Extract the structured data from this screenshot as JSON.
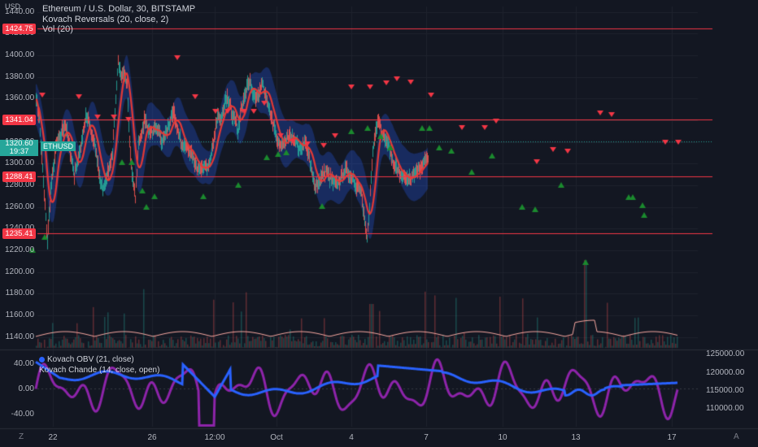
{
  "chart_data": {
    "type": "line",
    "title": "Ethereum / U.S. Dollar, 30, BITSTAMP",
    "symbol": "ETHUSD",
    "currency": "USD",
    "indicators": [
      "Kovach Reversals (20, close, 2)",
      "Vol (20)"
    ],
    "current_price": "1320.60",
    "countdown": "19:37",
    "levels": [
      1424.75,
      1341.04,
      1288.41,
      1235.41
    ],
    "ylim": [
      1130,
      1445
    ],
    "y_ticks": [
      "1440.00",
      "1420.00",
      "1400.00",
      "1380.00",
      "1360.00",
      "1340.00",
      "1320.00",
      "1300.00",
      "1280.00",
      "1260.00",
      "1240.00",
      "1220.00",
      "1200.00",
      "1180.00",
      "1160.00",
      "1140.00"
    ],
    "x_ticks": [
      "22",
      "26",
      "12:00",
      "Oct",
      "4",
      "7",
      "10",
      "13",
      "17"
    ],
    "x": [
      0,
      4,
      7,
      11,
      14,
      18,
      22,
      25,
      29,
      32,
      36,
      40,
      43,
      47,
      50,
      54,
      58,
      61,
      65,
      68,
      72,
      76,
      79,
      83,
      86,
      90,
      94,
      97,
      101,
      104,
      108,
      112,
      115,
      119,
      122,
      126,
      130,
      133,
      137,
      140,
      144,
      148,
      151,
      155,
      158,
      162,
      166,
      169,
      173,
      176,
      180,
      184,
      187,
      191,
      194,
      198,
      202,
      205,
      209,
      212,
      216,
      220,
      223,
      227,
      230,
      234,
      238,
      241,
      245,
      248,
      252,
      256,
      259,
      263,
      266,
      270,
      274,
      277,
      281,
      284,
      288,
      292,
      295,
      299,
      302,
      306,
      310,
      313,
      317,
      320,
      324,
      328,
      331,
      335,
      338,
      342,
      346,
      349,
      353,
      356,
      360,
      364,
      367,
      371,
      374,
      378,
      382,
      385,
      389,
      392,
      396,
      400,
      403,
      407,
      410,
      414,
      418,
      421,
      425,
      428,
      432,
      436,
      439,
      443,
      446,
      450,
      454,
      457,
      461,
      464,
      468,
      472,
      475,
      479,
      482,
      486,
      490,
      493,
      497,
      500,
      504,
      508,
      511,
      515,
      518,
      522,
      526,
      529,
      533,
      536,
      540,
      544,
      547,
      551,
      554,
      558,
      562,
      565,
      569,
      572,
      576,
      580,
      583,
      587,
      590,
      594,
      598,
      601,
      605,
      608,
      612,
      616,
      619,
      623,
      626,
      630,
      634,
      637,
      641,
      644,
      648,
      652,
      655,
      659,
      662,
      666,
      670,
      673,
      677,
      680,
      684,
      688,
      691,
      695,
      698,
      702,
      706,
      709,
      713,
      716,
      720,
      724,
      727,
      731,
      734,
      738,
      742,
      745,
      749,
      752,
      756,
      760,
      763,
      767,
      770,
      774,
      778,
      781,
      785,
      788,
      792,
      796,
      799,
      803,
      806,
      810,
      814,
      817,
      821,
      824,
      828,
      832,
      835
    ],
    "close": [
      1362,
      1340,
      1305,
      1260,
      1228,
      1278,
      1300,
      1318,
      1322,
      1330,
      1338,
      1318,
      1308,
      1290,
      1300,
      1310,
      1332,
      1344,
      1338,
      1327,
      1316,
      1300,
      1282,
      1277,
      1288,
      1295,
      1312,
      1345,
      1396,
      1384,
      1385,
      1372,
      1320,
      1283,
      1270,
      1318,
      1330,
      1340,
      1335,
      1330,
      1328,
      1332,
      1330,
      1318,
      1325,
      1333,
      1342,
      1346,
      1336,
      1324,
      1316,
      1316,
      1312,
      1310,
      1302,
      1295,
      1292,
      1298,
      1296,
      1300,
      1312,
      1330,
      1345,
      1340,
      1350,
      1360,
      1356,
      1345,
      1340,
      1330,
      1352,
      1360,
      1370,
      1376,
      1366,
      1358,
      1362,
      1374,
      1368,
      1355,
      1346,
      1335,
      1325,
      1315,
      1318,
      1320,
      1324,
      1326,
      1324,
      1320,
      1312,
      1318,
      1320,
      1308,
      1295,
      1280,
      1282,
      1286,
      1290,
      1294,
      1288,
      1284,
      1280,
      1282,
      1286,
      1292,
      1294,
      1290,
      1288,
      1282,
      1278,
      1272,
      1250,
      1230,
      1260,
      1312,
      1335,
      1340,
      1330,
      1325,
      1318,
      1308,
      1300,
      1296,
      1292,
      1288,
      1285,
      1284,
      1286,
      1290,
      1292,
      1296,
      1300,
      1303,
      1306
    ],
    "kovach_reversals_tops": [
      [
        52,
        118
      ],
      [
        97,
        120
      ],
      [
        120,
        145
      ],
      [
        140,
        145
      ],
      [
        158,
        148
      ],
      [
        218,
        72
      ],
      [
        240,
        120
      ],
      [
        265,
        138
      ],
      [
        280,
        138
      ],
      [
        300,
        138
      ],
      [
        312,
        138
      ],
      [
        325,
        128
      ],
      [
        345,
        168
      ],
      [
        360,
        175
      ],
      [
        378,
        178
      ],
      [
        398,
        180
      ],
      [
        412,
        168
      ],
      [
        432,
        108
      ],
      [
        455,
        108
      ],
      [
        475,
        103
      ],
      [
        488,
        98
      ],
      [
        505,
        102
      ],
      [
        530,
        118
      ],
      [
        568,
        158
      ],
      [
        596,
        158
      ],
      [
        610,
        150
      ],
      [
        660,
        200
      ],
      [
        680,
        185
      ],
      [
        698,
        187
      ],
      [
        738,
        140
      ],
      [
        752,
        142
      ],
      [
        818,
        176
      ],
      [
        834,
        176
      ]
    ],
    "kovach_reversals_bottoms": [
      [
        40,
        308
      ],
      [
        55,
        292
      ],
      [
        150,
        200
      ],
      [
        162,
        200
      ],
      [
        175,
        235
      ],
      [
        180,
        255
      ],
      [
        190,
        242
      ],
      [
        250,
        242
      ],
      [
        293,
        228
      ],
      [
        328,
        194
      ],
      [
        342,
        190
      ],
      [
        352,
        188
      ],
      [
        396,
        254
      ],
      [
        432,
        162
      ],
      [
        452,
        158
      ],
      [
        468,
        168
      ],
      [
        480,
        182
      ],
      [
        519,
        158
      ],
      [
        528,
        158
      ],
      [
        540,
        182
      ],
      [
        555,
        186
      ],
      [
        580,
        212
      ],
      [
        605,
        192
      ],
      [
        642,
        255
      ],
      [
        658,
        258
      ],
      [
        690,
        228
      ],
      [
        720,
        323
      ],
      [
        773,
        243
      ],
      [
        778,
        243
      ],
      [
        790,
        253
      ],
      [
        792,
        265
      ]
    ],
    "volume_ylim": [
      0,
      200
    ],
    "obv": {
      "name": "Kovach OBV (21, close)",
      "color": "#2962ff",
      "ylim": [
        105000,
        126000
      ],
      "ticks": [
        "125000.00",
        "120000.00",
        "115000.00",
        "110000.00"
      ]
    },
    "chande": {
      "name": "Kovach Chande (14, close, open)",
      "color": "#9c27b0",
      "ylim": [
        -60,
        60
      ],
      "ticks": [
        "40.00",
        "0.00",
        "-40.00"
      ]
    }
  },
  "ui": {
    "timezone_button": "Z",
    "auto_button": "A"
  }
}
